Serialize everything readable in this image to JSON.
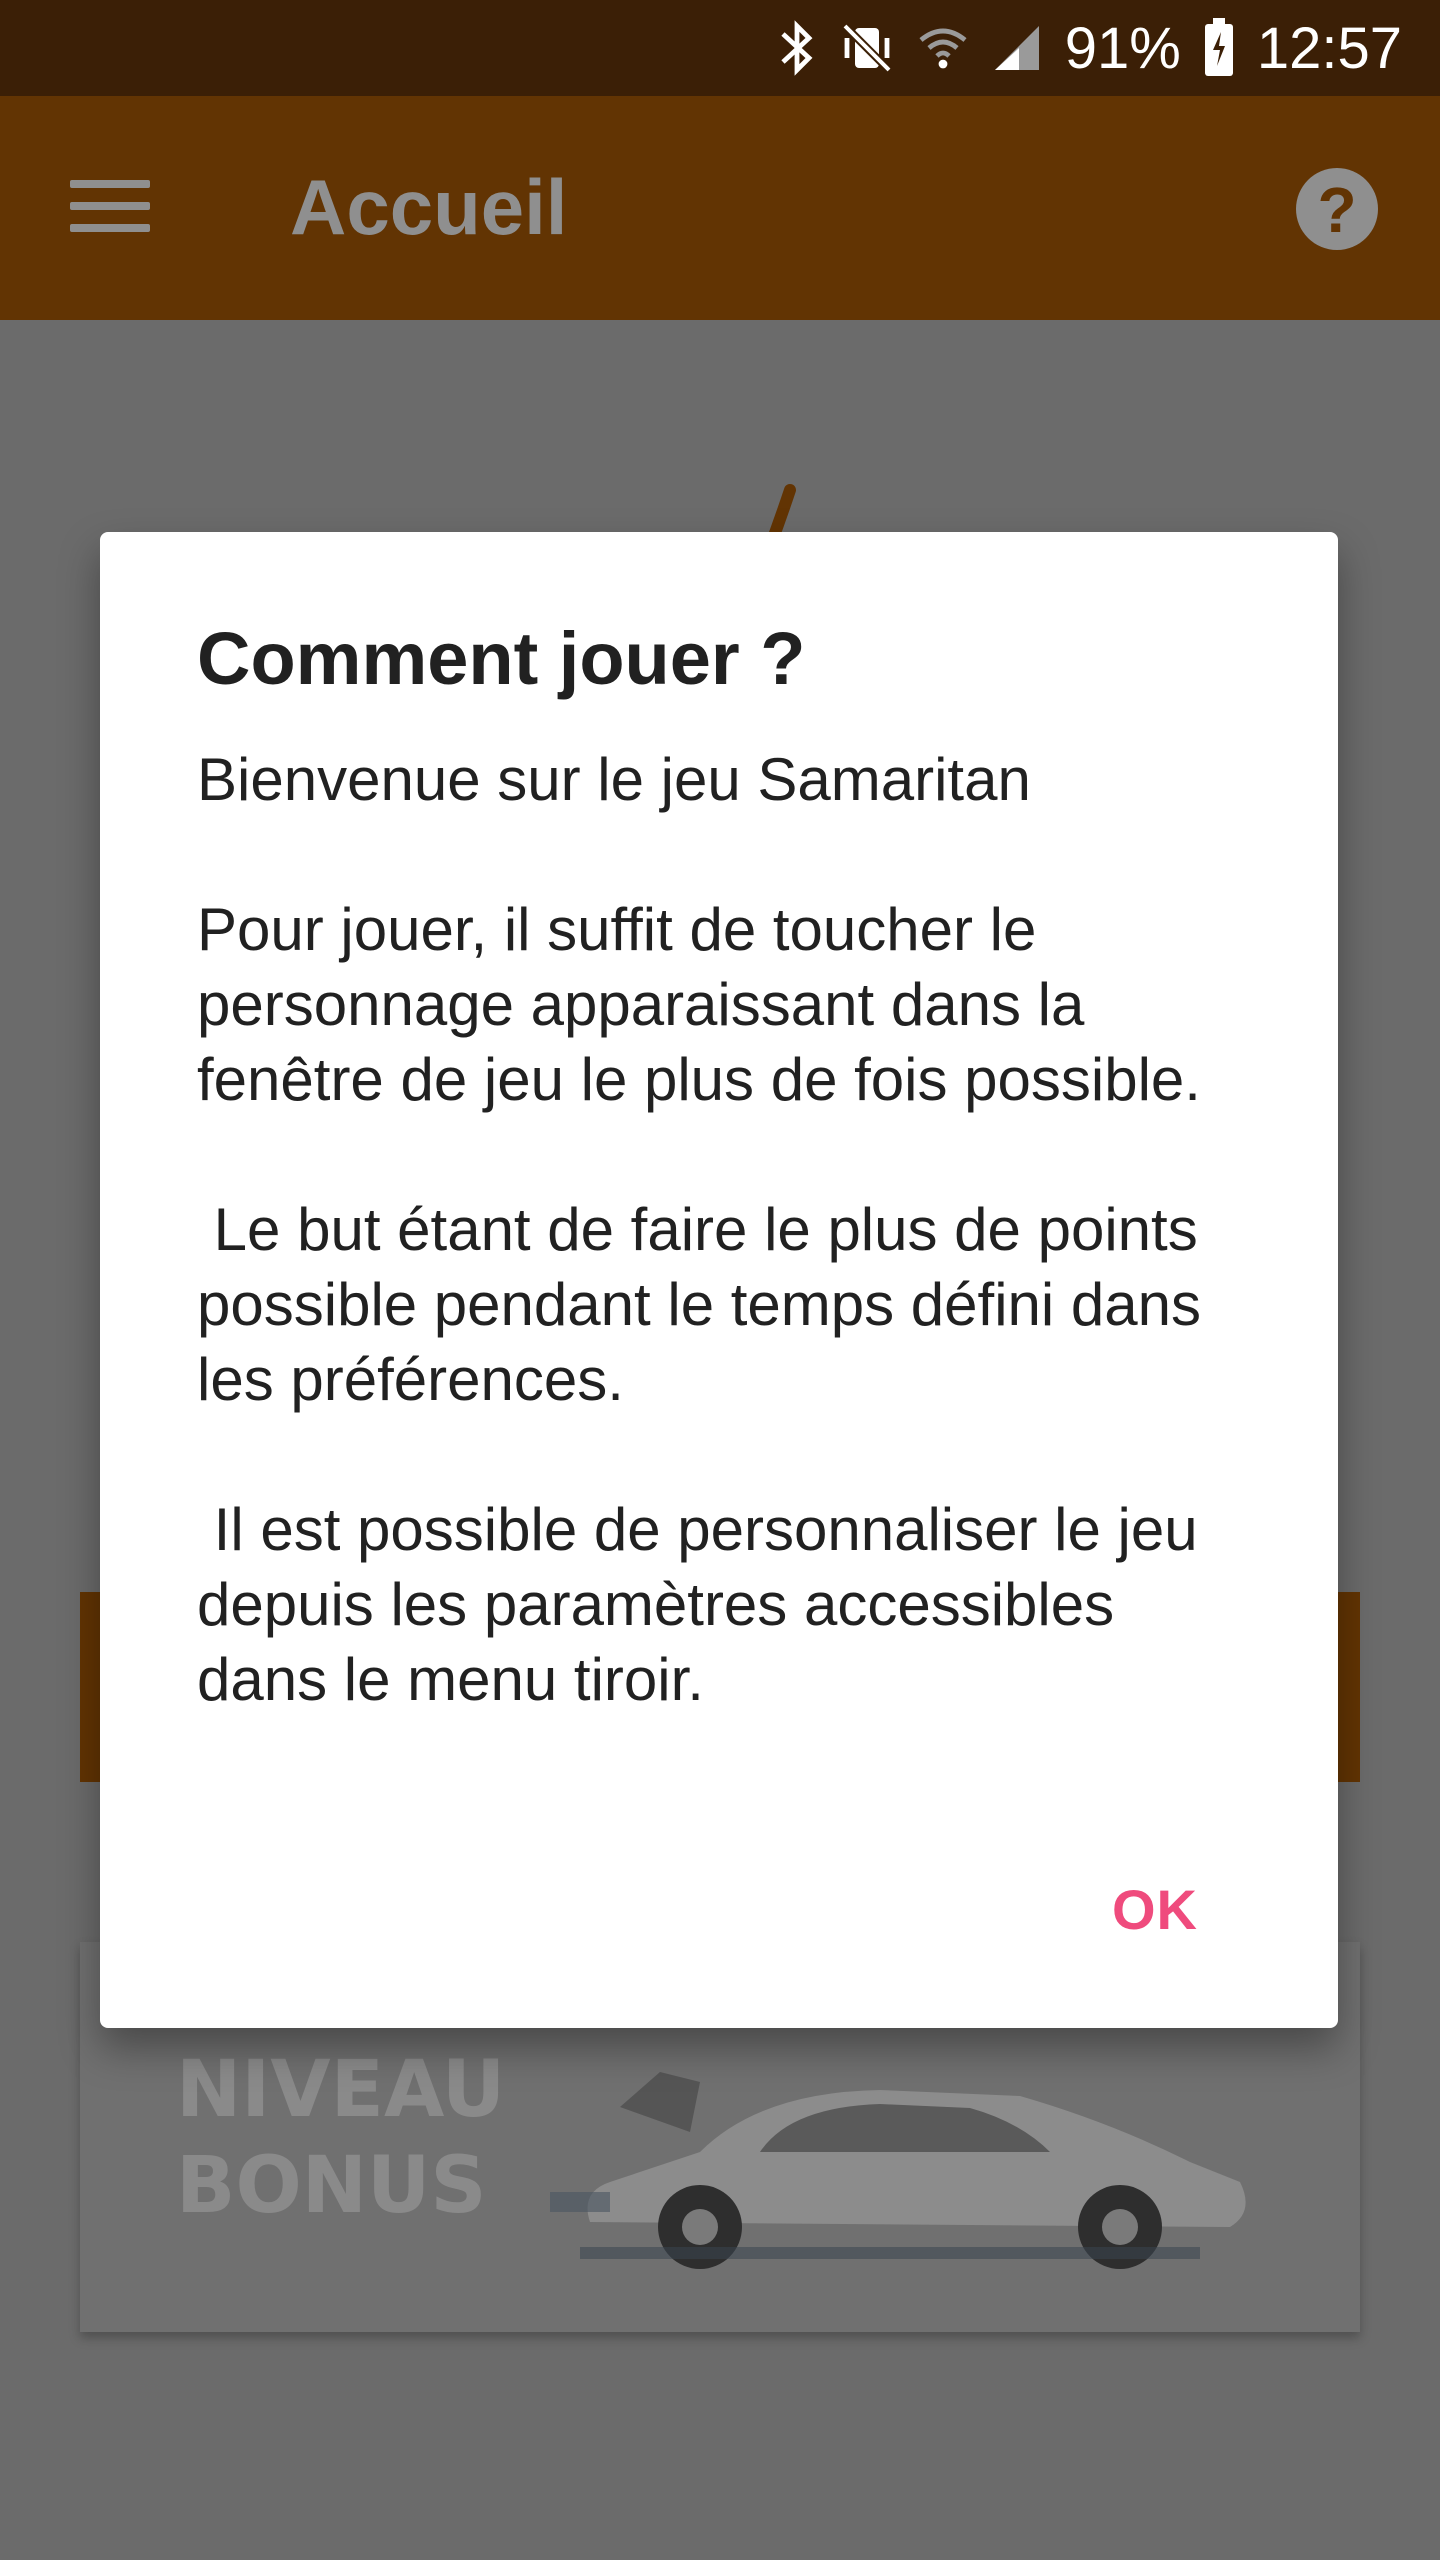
{
  "status_bar": {
    "battery": "91%",
    "time": "12:57",
    "icons": [
      "bluetooth-icon",
      "vibrate-mute-icon",
      "wifi-icon",
      "cell-signal-icon",
      "battery-charging-icon"
    ]
  },
  "toolbar": {
    "title": "Accueil",
    "menu_icon": "hamburger-menu-icon",
    "help_icon": "help-circle-icon",
    "help_glyph": "?"
  },
  "background": {
    "bonus_label_line1": "NIVEAU",
    "bonus_label_line2": "BONUS"
  },
  "dialog": {
    "title": "Comment jouer ?",
    "message": "Bienvenue sur le jeu Samaritan\n\nPour jouer, il suffit de toucher le personnage apparaissant dans la fenêtre de jeu le plus de fois possible.\n\n Le but étant de faire le plus de points possible pendant le temps défini dans les préférences.\n\n Il est possible de personnaliser le jeu depuis les paramètres accessibles dans le menu tiroir.",
    "ok_label": "OK"
  },
  "colors": {
    "status_bar": "#3b1f06",
    "toolbar": "#623403",
    "accent": "#ef4b7d",
    "scrim": "#6b6b6b"
  }
}
